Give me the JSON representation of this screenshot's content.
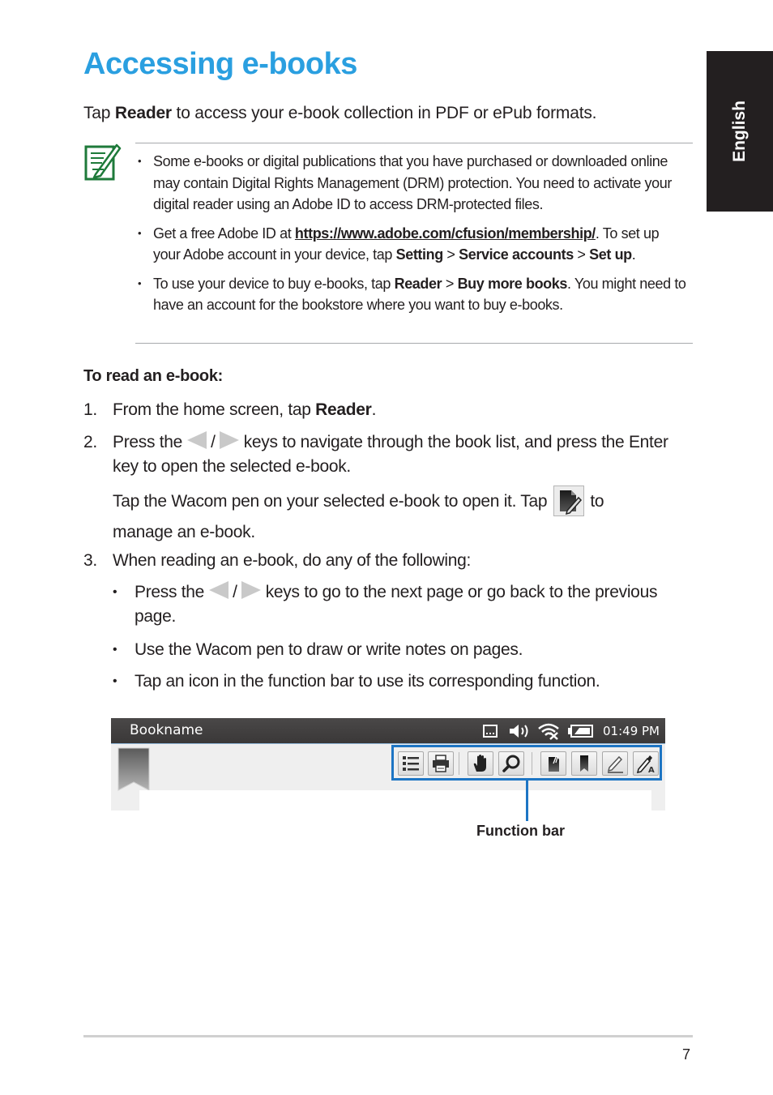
{
  "page": {
    "title": "Accessing e-books",
    "language_tab": "English",
    "page_number": "7"
  },
  "intro": {
    "pre": "Tap ",
    "bold": "Reader",
    "post": " to access your e-book collection in PDF or ePub formats."
  },
  "note": {
    "icon": "note-pencil-icon",
    "accent_color": "#1e7a3a",
    "items": [
      {
        "text": "Some e-books or digital publications that you have purchased or downloaded online may contain Digital Rights Management (DRM) protection. You need to activate your digital reader using an Adobe ID to access DRM-protected files."
      },
      {
        "pre": "Get a free Adobe ID at ",
        "link": "https://www.adobe.com/cfusion/membership/",
        "mid1": ". To set up your Adobe account in your device, tap ",
        "b1": "Setting",
        "sep1": " > ",
        "b2": "Service accounts",
        "sep2": " > ",
        "b3": "Set up",
        "end": "."
      },
      {
        "pre": "To use your device to buy e-books, tap ",
        "b1": "Reader",
        "sep1": " > ",
        "b2": "Buy more books",
        "post": ". You might need to have an account for the bookstore where you want to buy e-books."
      }
    ]
  },
  "procedure": {
    "heading": "To read an e-book:",
    "steps": [
      {
        "num": "1.",
        "pre": "From the home screen, tap ",
        "bold": "Reader",
        "post": "."
      },
      {
        "num": "2.",
        "pre": "Press the ",
        "slash": " / ",
        "post": " keys to navigate through the book list, and press the Enter key to open the selected e-book.",
        "extra_pre": "Tap the Wacom pen on your selected e-book to open it. Tap ",
        "extra_post": " to manage an e-book."
      },
      {
        "num": "3.",
        "text": "When reading an e-book, do any of the following:",
        "bullets": [
          {
            "pre": "Press the ",
            "slash": " / ",
            "post": " keys to go to the next page or go back to the previous page."
          },
          {
            "text": "Use the Wacom pen to draw or write notes on pages."
          },
          {
            "text": "Tap an icon in the function bar to use its corresponding function."
          }
        ]
      }
    ]
  },
  "device_screen": {
    "book_name": "Bookname",
    "clock": "01:49 PM",
    "status_icons": [
      "keyboard-icon",
      "volume-icon",
      "wifi-off-icon",
      "battery-icon"
    ],
    "function_bar_label": "Function bar",
    "function_bar_color": "#1d75c4",
    "function_buttons": [
      "table-of-contents-icon",
      "print-icon",
      "hand-pan-icon",
      "zoom-search-icon",
      "note-clip-icon",
      "bookmark-icon",
      "pencil-icon",
      "pen-text-icon"
    ]
  }
}
